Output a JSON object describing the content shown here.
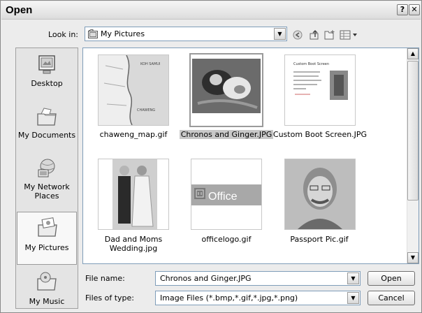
{
  "window": {
    "title": "Open",
    "help_glyph": "?",
    "close_glyph": "✕"
  },
  "look_in": {
    "label": "Look in:",
    "value": "My Pictures"
  },
  "places": [
    {
      "label": "Desktop",
      "icon": "desktop-icon"
    },
    {
      "label": "My Documents",
      "icon": "my-documents-icon"
    },
    {
      "label": "My Network Places",
      "icon": "network-icon"
    },
    {
      "label": "My Pictures",
      "icon": "my-pictures-icon",
      "selected": true
    },
    {
      "label": "My Music",
      "icon": "my-music-icon"
    }
  ],
  "files": [
    {
      "name": "chaweng_map.gif"
    },
    {
      "name": "Chronos and Ginger.JPG",
      "selected": true
    },
    {
      "name": "Custom Boot Screen.JPG"
    },
    {
      "name": "Dad and Moms Wedding.jpg"
    },
    {
      "name": "officelogo.gif",
      "logo_text": "Office"
    },
    {
      "name": "Passport Pic.gif"
    }
  ],
  "thumb_text": {
    "map_top": "KOH SAMUI",
    "map_bottom": "CHAWENG",
    "doc_heading": "Custom Boot Screen"
  },
  "file_name": {
    "label": "File name:",
    "value": "Chronos and Ginger.JPG"
  },
  "file_type": {
    "label": "Files of type:",
    "value": "Image Files (*.bmp,*.gif,*.jpg,*.png)"
  },
  "buttons": {
    "open": "Open",
    "cancel": "Cancel"
  },
  "colors": {
    "office_logo": "#cc4a1a",
    "selection_gray": "#c8c8c8"
  }
}
